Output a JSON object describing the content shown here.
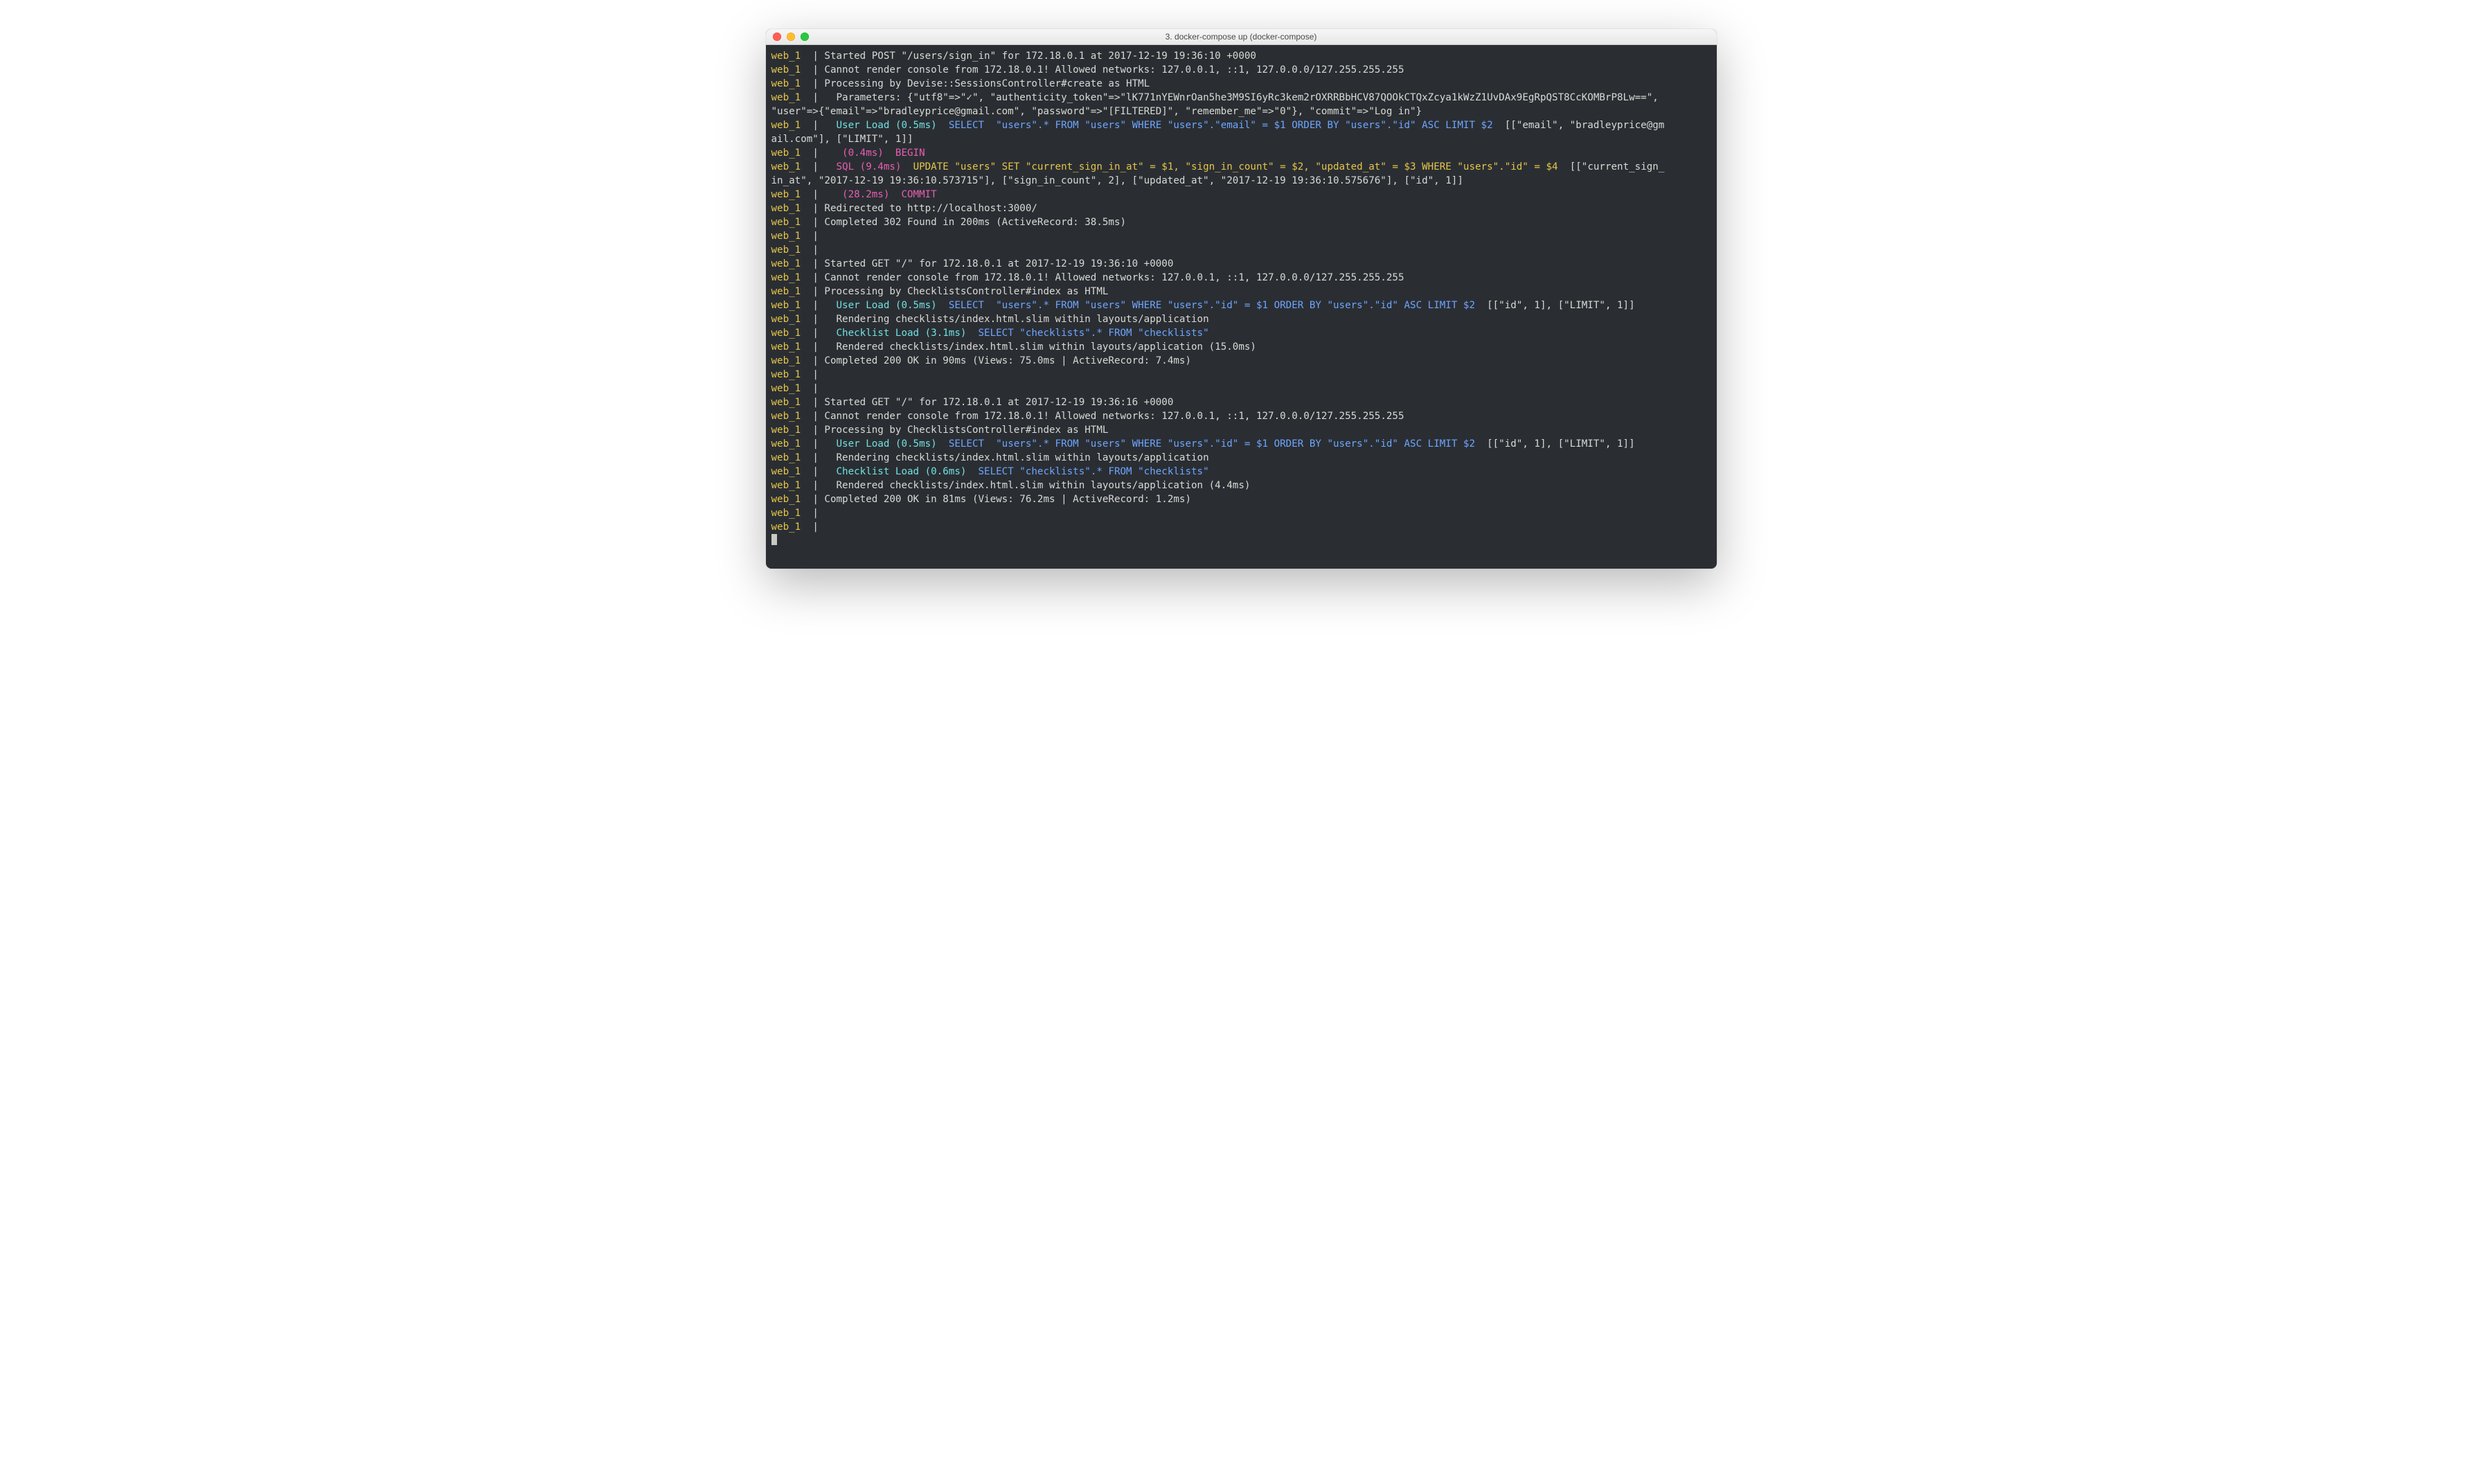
{
  "window": {
    "title": "3. docker-compose up (docker-compose)"
  },
  "colors": {
    "plain": "c-plain",
    "yellow": "c-yellow",
    "cyan": "c-cyan",
    "magenta": "c-magenta",
    "blue": "c-blue"
  },
  "prefix": {
    "text": "web_1",
    "color": "yellow"
  },
  "sep": {
    "text": "|",
    "color": "plain"
  },
  "lines": [
    {
      "prefixed": true,
      "segs": [
        {
          "t": "Started POST \"/users/sign_in\" for 172.18.0.1 at 2017-12-19 19:36:10 +0000",
          "c": "plain"
        }
      ]
    },
    {
      "prefixed": true,
      "segs": [
        {
          "t": "Cannot render console from 172.18.0.1! Allowed networks: 127.0.0.1, ::1, 127.0.0.0/127.255.255.255",
          "c": "plain"
        }
      ]
    },
    {
      "prefixed": true,
      "segs": [
        {
          "t": "Processing by Devise::SessionsController#create as HTML",
          "c": "plain"
        }
      ]
    },
    {
      "prefixed": true,
      "segs": [
        {
          "t": "  Parameters: {\"utf8\"=>\"✓\", \"authenticity_token\"=>\"lK771nYEWnrOan5he3M9SI6yRc3kem2rOXRRBbHCV87QOOkCTQxZcya1kWzZ1UvDAx9EgRpQST8CcKOMBrP8Lw==\", ",
          "c": "plain"
        }
      ]
    },
    {
      "prefixed": false,
      "segs": [
        {
          "t": "\"user\"=>{\"email\"=>\"bradleyprice@gmail.com\", \"password\"=>\"[FILTERED]\", \"remember_me\"=>\"0\"}, \"commit\"=>\"Log in\"}",
          "c": "plain"
        }
      ]
    },
    {
      "prefixed": true,
      "segs": [
        {
          "t": "  ",
          "c": "plain"
        },
        {
          "t": "User Load (0.5ms)",
          "c": "cyan"
        },
        {
          "t": "  ",
          "c": "plain"
        },
        {
          "t": "SELECT  \"users\".* FROM \"users\" WHERE \"users\".\"email\" = $1 ORDER BY \"users\".\"id\" ASC LIMIT $2",
          "c": "blue"
        },
        {
          "t": "  [[\"email\", \"bradleyprice@gm",
          "c": "plain"
        }
      ]
    },
    {
      "prefixed": false,
      "segs": [
        {
          "t": "ail.com\"], [\"LIMIT\", 1]]",
          "c": "plain"
        }
      ]
    },
    {
      "prefixed": true,
      "segs": [
        {
          "t": "   ",
          "c": "plain"
        },
        {
          "t": "(0.4ms)",
          "c": "magenta"
        },
        {
          "t": "  ",
          "c": "plain"
        },
        {
          "t": "BEGIN",
          "c": "magenta"
        }
      ]
    },
    {
      "prefixed": true,
      "segs": [
        {
          "t": "  ",
          "c": "plain"
        },
        {
          "t": "SQL (9.4ms)",
          "c": "magenta"
        },
        {
          "t": "  ",
          "c": "plain"
        },
        {
          "t": "UPDATE \"users\" SET \"current_sign_in_at\" = $1, \"sign_in_count\" = $2, \"updated_at\" = $3 WHERE \"users\".\"id\" = $4",
          "c": "yellow"
        },
        {
          "t": "  [[\"current_sign_",
          "c": "plain"
        }
      ]
    },
    {
      "prefixed": false,
      "segs": [
        {
          "t": "in_at\", \"2017-12-19 19:36:10.573715\"], [\"sign_in_count\", 2], [\"updated_at\", \"2017-12-19 19:36:10.575676\"], [\"id\", 1]]",
          "c": "plain"
        }
      ]
    },
    {
      "prefixed": true,
      "segs": [
        {
          "t": "   ",
          "c": "plain"
        },
        {
          "t": "(28.2ms)",
          "c": "magenta"
        },
        {
          "t": "  ",
          "c": "plain"
        },
        {
          "t": "COMMIT",
          "c": "magenta"
        }
      ]
    },
    {
      "prefixed": true,
      "segs": [
        {
          "t": "Redirected to http://localhost:3000/",
          "c": "plain"
        }
      ]
    },
    {
      "prefixed": true,
      "segs": [
        {
          "t": "Completed 302 Found in 200ms (ActiveRecord: 38.5ms)",
          "c": "plain"
        }
      ]
    },
    {
      "prefixed": true,
      "segs": []
    },
    {
      "prefixed": true,
      "segs": []
    },
    {
      "prefixed": true,
      "segs": [
        {
          "t": "Started GET \"/\" for 172.18.0.1 at 2017-12-19 19:36:10 +0000",
          "c": "plain"
        }
      ]
    },
    {
      "prefixed": true,
      "segs": [
        {
          "t": "Cannot render console from 172.18.0.1! Allowed networks: 127.0.0.1, ::1, 127.0.0.0/127.255.255.255",
          "c": "plain"
        }
      ]
    },
    {
      "prefixed": true,
      "segs": [
        {
          "t": "Processing by ChecklistsController#index as HTML",
          "c": "plain"
        }
      ]
    },
    {
      "prefixed": true,
      "segs": [
        {
          "t": "  ",
          "c": "plain"
        },
        {
          "t": "User Load (0.5ms)",
          "c": "cyan"
        },
        {
          "t": "  ",
          "c": "plain"
        },
        {
          "t": "SELECT  \"users\".* FROM \"users\" WHERE \"users\".\"id\" = $1 ORDER BY \"users\".\"id\" ASC LIMIT $2",
          "c": "blue"
        },
        {
          "t": "  [[\"id\", 1], [\"LIMIT\", 1]]",
          "c": "plain"
        }
      ]
    },
    {
      "prefixed": true,
      "segs": [
        {
          "t": "  Rendering checklists/index.html.slim within layouts/application",
          "c": "plain"
        }
      ]
    },
    {
      "prefixed": true,
      "segs": [
        {
          "t": "  ",
          "c": "plain"
        },
        {
          "t": "Checklist Load (3.1ms)",
          "c": "cyan"
        },
        {
          "t": "  ",
          "c": "plain"
        },
        {
          "t": "SELECT \"checklists\".* FROM \"checklists\"",
          "c": "blue"
        }
      ]
    },
    {
      "prefixed": true,
      "segs": [
        {
          "t": "  Rendered checklists/index.html.slim within layouts/application (15.0ms)",
          "c": "plain"
        }
      ]
    },
    {
      "prefixed": true,
      "segs": [
        {
          "t": "Completed 200 OK in 90ms (Views: 75.0ms | ActiveRecord: 7.4ms)",
          "c": "plain"
        }
      ]
    },
    {
      "prefixed": true,
      "segs": []
    },
    {
      "prefixed": true,
      "segs": []
    },
    {
      "prefixed": true,
      "segs": [
        {
          "t": "Started GET \"/\" for 172.18.0.1 at 2017-12-19 19:36:16 +0000",
          "c": "plain"
        }
      ]
    },
    {
      "prefixed": true,
      "segs": [
        {
          "t": "Cannot render console from 172.18.0.1! Allowed networks: 127.0.0.1, ::1, 127.0.0.0/127.255.255.255",
          "c": "plain"
        }
      ]
    },
    {
      "prefixed": true,
      "segs": [
        {
          "t": "Processing by ChecklistsController#index as HTML",
          "c": "plain"
        }
      ]
    },
    {
      "prefixed": true,
      "segs": [
        {
          "t": "  ",
          "c": "plain"
        },
        {
          "t": "User Load (0.5ms)",
          "c": "cyan"
        },
        {
          "t": "  ",
          "c": "plain"
        },
        {
          "t": "SELECT  \"users\".* FROM \"users\" WHERE \"users\".\"id\" = $1 ORDER BY \"users\".\"id\" ASC LIMIT $2",
          "c": "blue"
        },
        {
          "t": "  [[\"id\", 1], [\"LIMIT\", 1]]",
          "c": "plain"
        }
      ]
    },
    {
      "prefixed": true,
      "segs": [
        {
          "t": "  Rendering checklists/index.html.slim within layouts/application",
          "c": "plain"
        }
      ]
    },
    {
      "prefixed": true,
      "segs": [
        {
          "t": "  ",
          "c": "plain"
        },
        {
          "t": "Checklist Load (0.6ms)",
          "c": "cyan"
        },
        {
          "t": "  ",
          "c": "plain"
        },
        {
          "t": "SELECT \"checklists\".* FROM \"checklists\"",
          "c": "blue"
        }
      ]
    },
    {
      "prefixed": true,
      "segs": [
        {
          "t": "  Rendered checklists/index.html.slim within layouts/application (4.4ms)",
          "c": "plain"
        }
      ]
    },
    {
      "prefixed": true,
      "segs": [
        {
          "t": "Completed 200 OK in 81ms (Views: 76.2ms | ActiveRecord: 1.2ms)",
          "c": "plain"
        }
      ]
    },
    {
      "prefixed": true,
      "segs": []
    },
    {
      "prefixed": true,
      "segs": []
    }
  ]
}
